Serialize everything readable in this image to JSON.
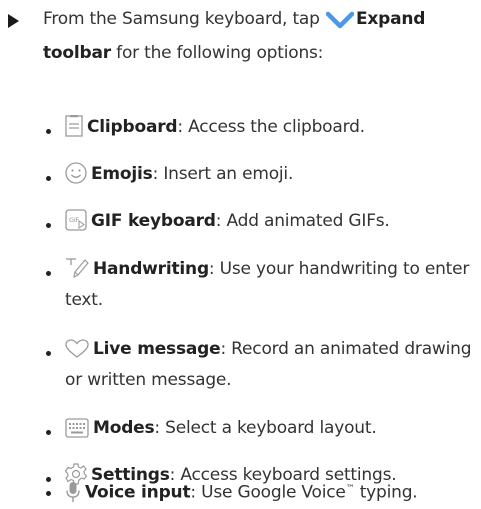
{
  "intro": {
    "text_before": "From the Samsung keyboard, tap",
    "expand_label": "Expand toolbar",
    "text_after": "for the following options:"
  },
  "items": [
    {
      "icon": "clipboard-icon",
      "label": "Clipboard",
      "desc": ": Access the clipboard."
    },
    {
      "icon": "emoji-icon",
      "label": "Emojis",
      "desc": ": Insert an emoji."
    },
    {
      "icon": "gif-icon",
      "label": "GIF keyboard",
      "desc": ": Add animated GIFs."
    },
    {
      "icon": "handwriting-icon",
      "label": "Handwriting",
      "desc": ": Use your handwriting to enter text."
    },
    {
      "icon": "live-message-icon",
      "label": "Live message",
      "desc": ": Record an animated drawing or written message."
    },
    {
      "icon": "keyboard-modes-icon",
      "label": "Modes",
      "desc": ": Select a keyboard layout."
    },
    {
      "icon": "settings-gear-icon",
      "label": "Settings",
      "desc": ": Access keyboard settings."
    },
    {
      "icon": "microphone-icon",
      "label": "Voice input",
      "desc": ": Use Google Voice",
      "tm": "™",
      "desc2": " typing."
    }
  ],
  "colors": {
    "text": "#333333",
    "accent": "#4d97e8",
    "icon": "#9a9a9a"
  }
}
